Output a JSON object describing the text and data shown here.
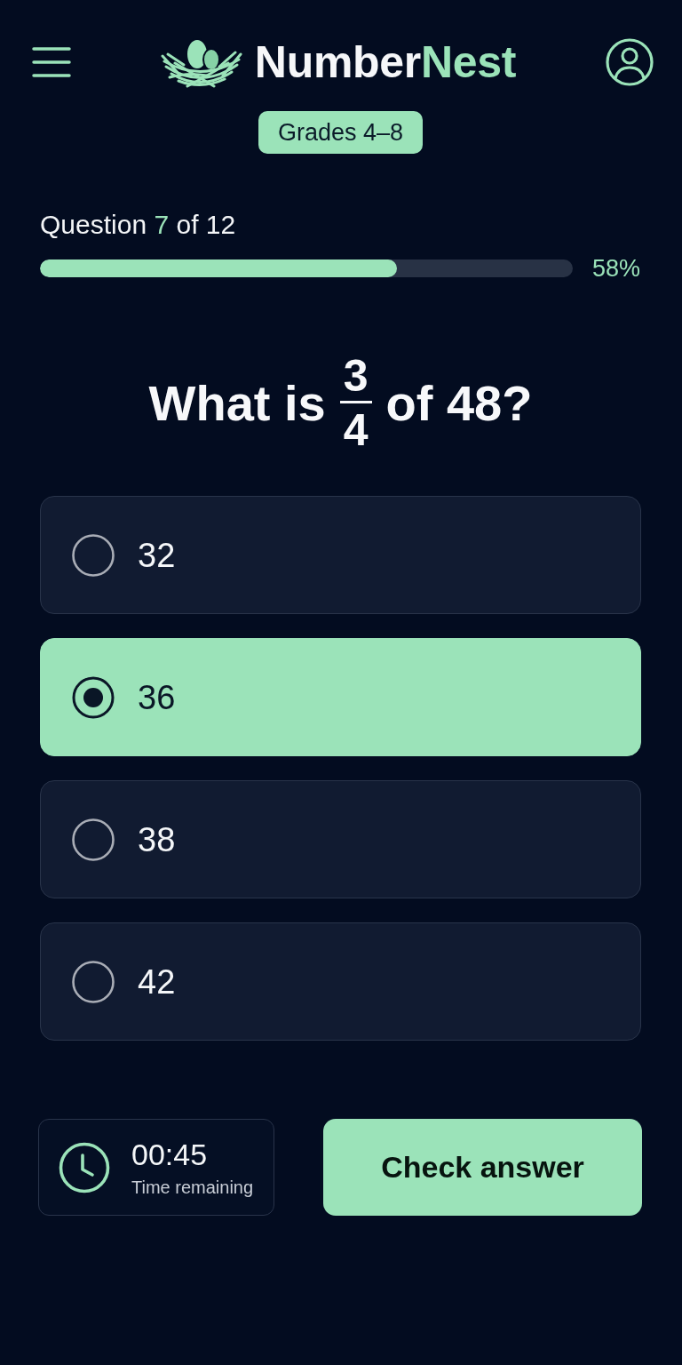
{
  "header": {
    "brand": {
      "name": "Number",
      "accent": "Nest"
    },
    "badge": "Grades 4–8"
  },
  "progress": {
    "label": "Question",
    "current": "7",
    "total_text": "of 12",
    "level": 0.67,
    "reading": "58%"
  },
  "question": {
    "prefix": "What is",
    "numerator": "3",
    "denominator": "4",
    "suffix": "of 48?"
  },
  "options": [
    {
      "label": "32",
      "selected": false
    },
    {
      "label": "36",
      "selected": true
    },
    {
      "label": "38",
      "selected": false
    },
    {
      "label": "42",
      "selected": false
    }
  ],
  "timer": {
    "time": "00:45",
    "caption": "Time remaining"
  },
  "actions": {
    "submit": "Check answer"
  }
}
